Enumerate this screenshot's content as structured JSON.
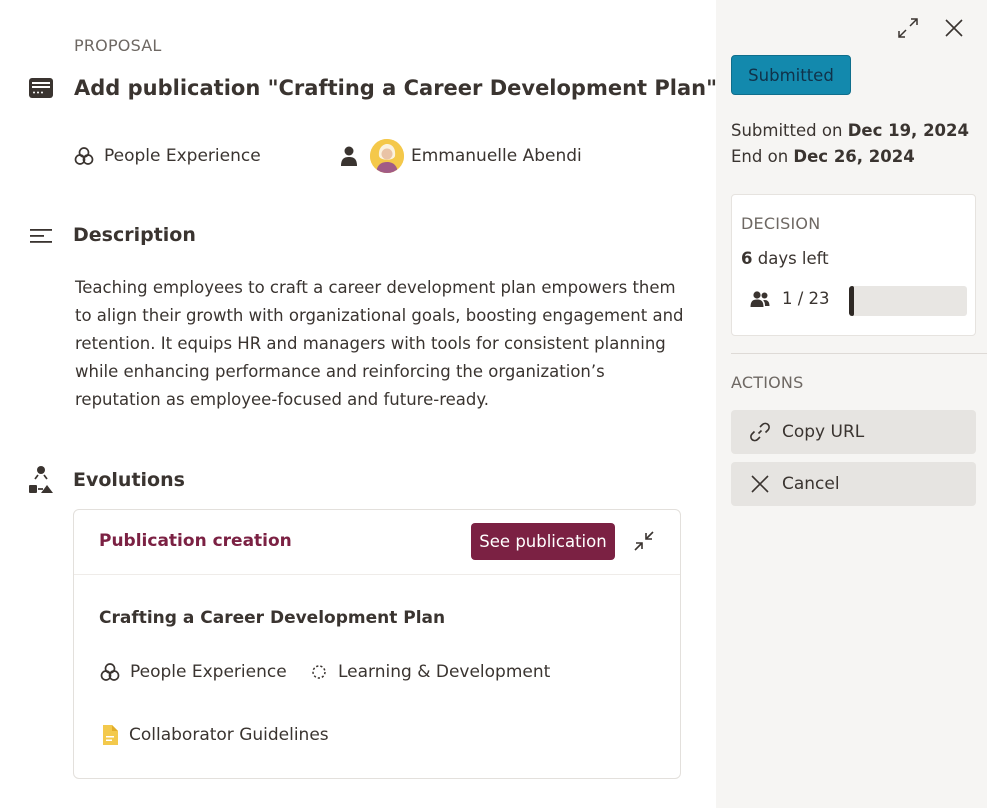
{
  "proposal": {
    "eyebrow": "PROPOSAL",
    "title": "Add publication \"Crafting a Career Development Plan\"",
    "team": "People Experience",
    "author": "Emmanuelle Abendi"
  },
  "description": {
    "heading": "Description",
    "text": "Teaching employees to craft a career development plan empowers them to align their growth with organizational goals, boosting engagement and retention. It equips HR and managers with tools for consistent planning while enhancing performance and reinforcing the organization’s reputation as employee-focused and future-ready."
  },
  "evolutions": {
    "heading": "Evolutions",
    "card": {
      "title": "Publication creation",
      "see_button": "See publication",
      "publication_name": "Crafting a Career Development Plan",
      "team": "People Experience",
      "category": "Learning & Development",
      "folder": "Collaborator Guidelines"
    }
  },
  "sidebar": {
    "status": "Submitted",
    "submitted_prefix": "Submitted on",
    "submitted_date": "Dec 19, 2024",
    "end_prefix": "End on",
    "end_date": "Dec 26, 2024",
    "decision": {
      "label": "DECISION",
      "days": "6",
      "days_suffix": "days left",
      "votes_text": "1 / 23",
      "votes_cast": 1,
      "votes_total": 23
    },
    "actions": {
      "label": "ACTIONS",
      "copy_url": "Copy URL",
      "cancel": "Cancel"
    }
  },
  "colors": {
    "accent": "#7b2143",
    "status": "#1389ad",
    "sidebar_bg": "#f6f5f3",
    "folder_icon": "#f3c94c"
  },
  "icons": [
    "proposal-card-icon",
    "team-icon",
    "person-icon",
    "description-lines-icon",
    "evolutions-icon",
    "shrink-icon",
    "category-dashed-circle-icon",
    "document-icon",
    "expand-icon",
    "close-icon",
    "users-icon",
    "link-icon",
    "cancel-x-icon"
  ]
}
